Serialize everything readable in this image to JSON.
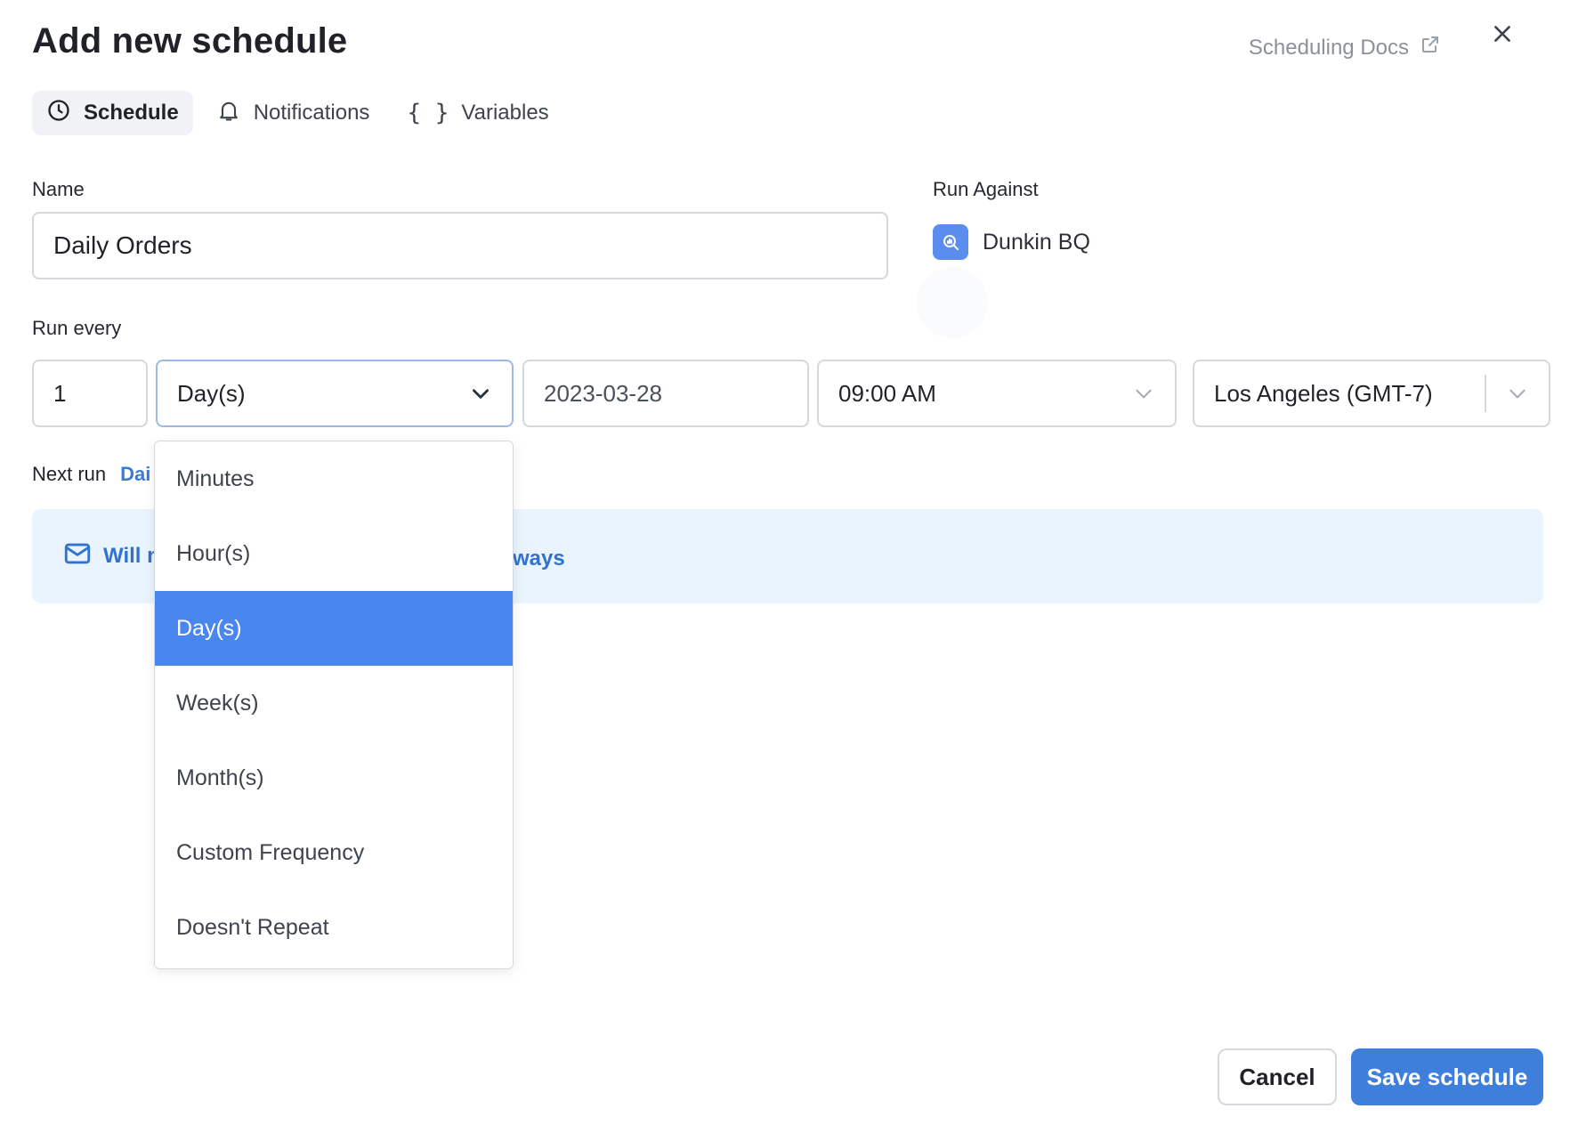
{
  "dialog": {
    "title": "Add new schedule",
    "docs_link": "Scheduling Docs"
  },
  "tabs": [
    {
      "label": "Schedule",
      "icon": "clock-icon",
      "active": true
    },
    {
      "label": "Notifications",
      "icon": "bell-icon",
      "active": false
    },
    {
      "label": "Variables",
      "icon": "braces-icon",
      "active": false
    }
  ],
  "form": {
    "name_label": "Name",
    "name_value": "Daily Orders",
    "run_against_label": "Run Against",
    "run_against_value": "Dunkin BQ",
    "run_every_label": "Run every",
    "interval_value": "1",
    "unit_value": "Day(s)",
    "date_value": "2023-03-28",
    "time_value": "09:00 AM",
    "timezone_value": "Los Angeles (GMT-7)",
    "next_run_label": "Next run",
    "next_run_value_visible": "Dai"
  },
  "notice": {
    "text_visible_start": "Will n",
    "text_visible_end": "ways"
  },
  "unit_dropdown": {
    "options": [
      "Minutes",
      "Hour(s)",
      "Day(s)",
      "Week(s)",
      "Month(s)",
      "Custom Frequency",
      "Doesn't Repeat"
    ],
    "selected": "Day(s)"
  },
  "footer": {
    "cancel_label": "Cancel",
    "save_label": "Save schedule"
  },
  "colors": {
    "accent": "#3f7fdc",
    "selected_option": "#4a86f0",
    "notice_bg": "#eaf4ff"
  }
}
